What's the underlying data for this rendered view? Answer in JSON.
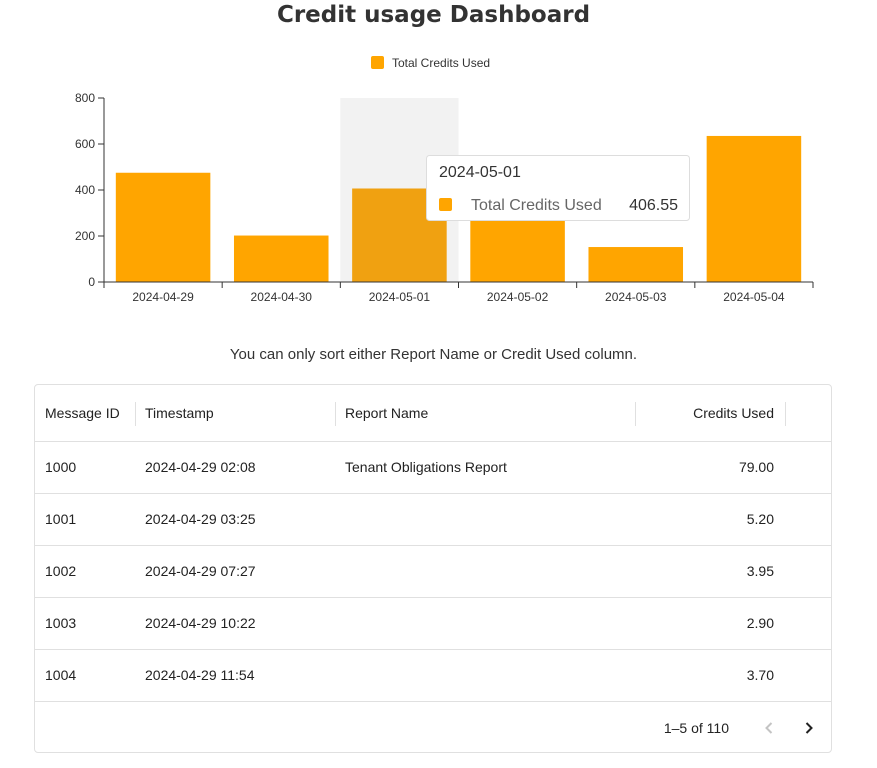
{
  "page": {
    "title": "Credit usage Dashboard",
    "note": "You can only sort either Report Name or Credit Used column."
  },
  "colors": {
    "bar": "#ffa500",
    "bar_hover": "#f0a111",
    "hover_band": "#f2f2f2",
    "text": "#333333"
  },
  "chart_data": {
    "type": "bar",
    "categories": [
      "2024-04-29",
      "2024-04-30",
      "2024-05-01",
      "2024-05-02",
      "2024-05-03",
      "2024-05-04"
    ],
    "series": [
      {
        "name": "Total Credits Used",
        "values": [
          475,
          202,
          406.55,
          270,
          152,
          635
        ]
      }
    ],
    "ylim": [
      0,
      800
    ],
    "yticks": [
      0,
      200,
      400,
      600,
      800
    ],
    "legend": "top-center",
    "grid": false,
    "highlighted_index": 2,
    "tooltip": {
      "title": "2024-05-01",
      "series_name": "Total Credits Used",
      "value": "406.55"
    }
  },
  "table": {
    "columns": [
      "Message ID",
      "Timestamp",
      "Report Name",
      "Credits Used"
    ],
    "rows": [
      {
        "id": "1000",
        "timestamp": "2024-04-29 02:08",
        "report": "Tenant Obligations Report",
        "credits": "79.00"
      },
      {
        "id": "1001",
        "timestamp": "2024-04-29 03:25",
        "report": "",
        "credits": "5.20"
      },
      {
        "id": "1002",
        "timestamp": "2024-04-29 07:27",
        "report": "",
        "credits": "3.95"
      },
      {
        "id": "1003",
        "timestamp": "2024-04-29 10:22",
        "report": "",
        "credits": "2.90"
      },
      {
        "id": "1004",
        "timestamp": "2024-04-29 11:54",
        "report": "",
        "credits": "3.70"
      }
    ],
    "pagination": "1–5 of 110"
  },
  "icons": {
    "prev": "chevron-left-icon",
    "next": "chevron-right-icon"
  }
}
